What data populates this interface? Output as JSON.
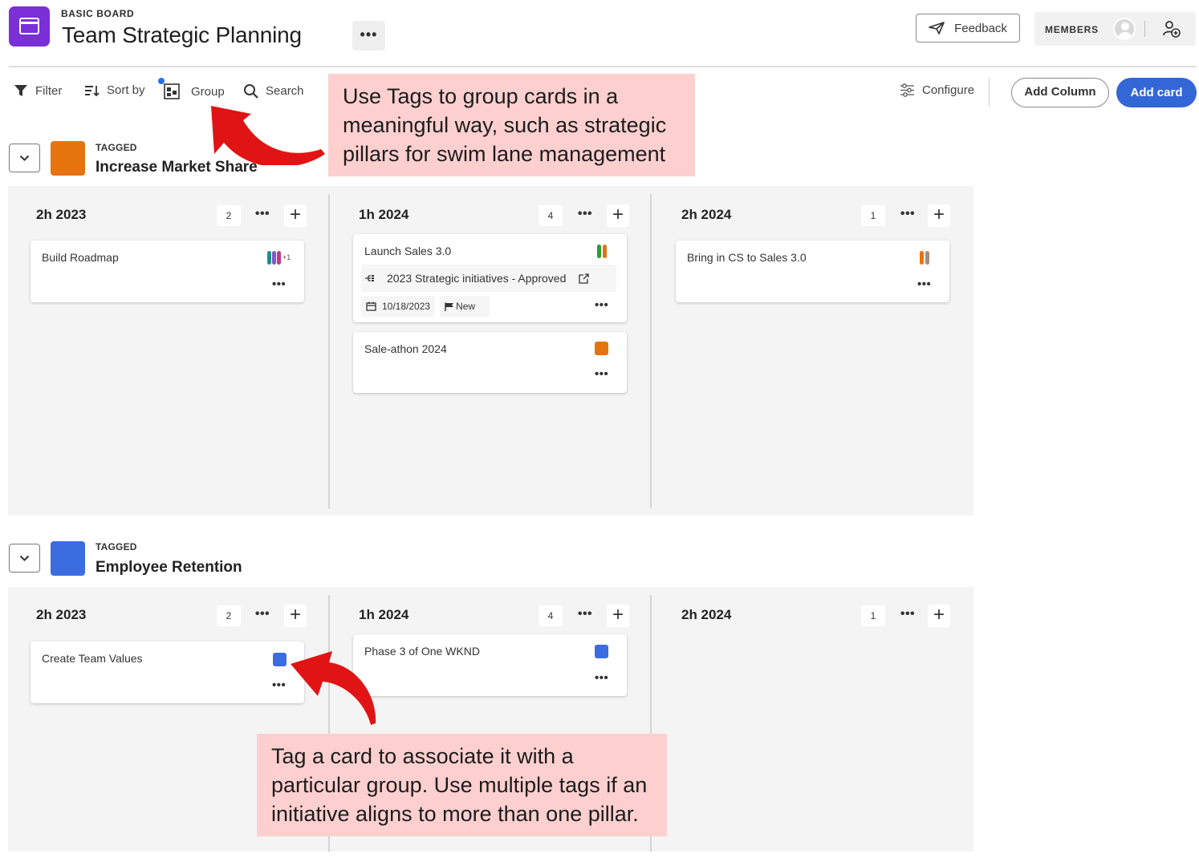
{
  "header": {
    "board_type": "BASIC BOARD",
    "board_title": "Team Strategic Planning",
    "more_label": "•••",
    "feedback_label": "Feedback",
    "members_label": "MEMBERS"
  },
  "toolbar": {
    "filter_label": "Filter",
    "sort_label": "Sort by",
    "group_label": "Group",
    "search_label": "Search",
    "configure_label": "Configure",
    "add_column_label": "Add Column",
    "add_card_label": "Add card"
  },
  "colors": {
    "accent_blue": "#3366d6",
    "app_purple": "#7b2fd6",
    "tag_orange": "#e5740f",
    "tag_blue": "#3b6ce0",
    "tag_green": "#2a9d3a",
    "tag_teal": "#1d8f8a",
    "tag_magenta": "#c2378f",
    "tag_violet": "#7b2fd6",
    "callout_bg": "#fdd0cf",
    "arrow_red": "#e01414"
  },
  "lanes": [
    {
      "kicker": "TAGGED",
      "name": "Increase Market Share",
      "color": "#e5740f",
      "columns": [
        {
          "title": "2h 2023",
          "count": "2",
          "cards": [
            {
              "title": "Build Roadmap",
              "tag_overflow": "+1",
              "more": "•••"
            }
          ]
        },
        {
          "title": "1h 2024",
          "count": "4",
          "cards": [
            {
              "title": "Launch Sales 3.0",
              "link_text": "2023 Strategic initiatives - Approved",
              "date": "10/18/2023",
              "status": "New",
              "more": "•••"
            },
            {
              "title": "Sale-athon 2024",
              "more": "•••"
            }
          ]
        },
        {
          "title": "2h 2024",
          "count": "1",
          "cards": [
            {
              "title": "Bring in CS to Sales 3.0",
              "more": "•••"
            }
          ]
        }
      ]
    },
    {
      "kicker": "TAGGED",
      "name": "Employee Retention",
      "color": "#3b6ce0",
      "columns": [
        {
          "title": "2h 2023",
          "count": "2",
          "cards": [
            {
              "title": "Create Team Values",
              "more": "•••"
            }
          ]
        },
        {
          "title": "1h 2024",
          "count": "4",
          "cards": [
            {
              "title": "Phase 3 of One WKND",
              "more": "•••"
            }
          ]
        },
        {
          "title": "2h 2024",
          "count": "1",
          "cards": []
        }
      ]
    }
  ],
  "callouts": {
    "top": "Use Tags to group cards in a meaningful way, such as strategic pillars for swim lane management",
    "bottom": "Tag a card to associate it with a particular group. Use multiple tags if an initiative aligns to more than one pillar."
  },
  "icons": {
    "app": "board-window-icon",
    "feedback": "paper-plane-icon",
    "avatar": "user-avatar-icon",
    "add_member": "add-user-icon",
    "filter": "funnel-icon",
    "sort": "sort-icon",
    "group": "group-icon",
    "search": "search-icon",
    "configure": "sliders-icon",
    "chevron": "chevron-down-icon",
    "link_type": "hierarchy-icon",
    "external": "external-link-icon",
    "calendar": "calendar-icon",
    "flag": "flag-icon"
  }
}
